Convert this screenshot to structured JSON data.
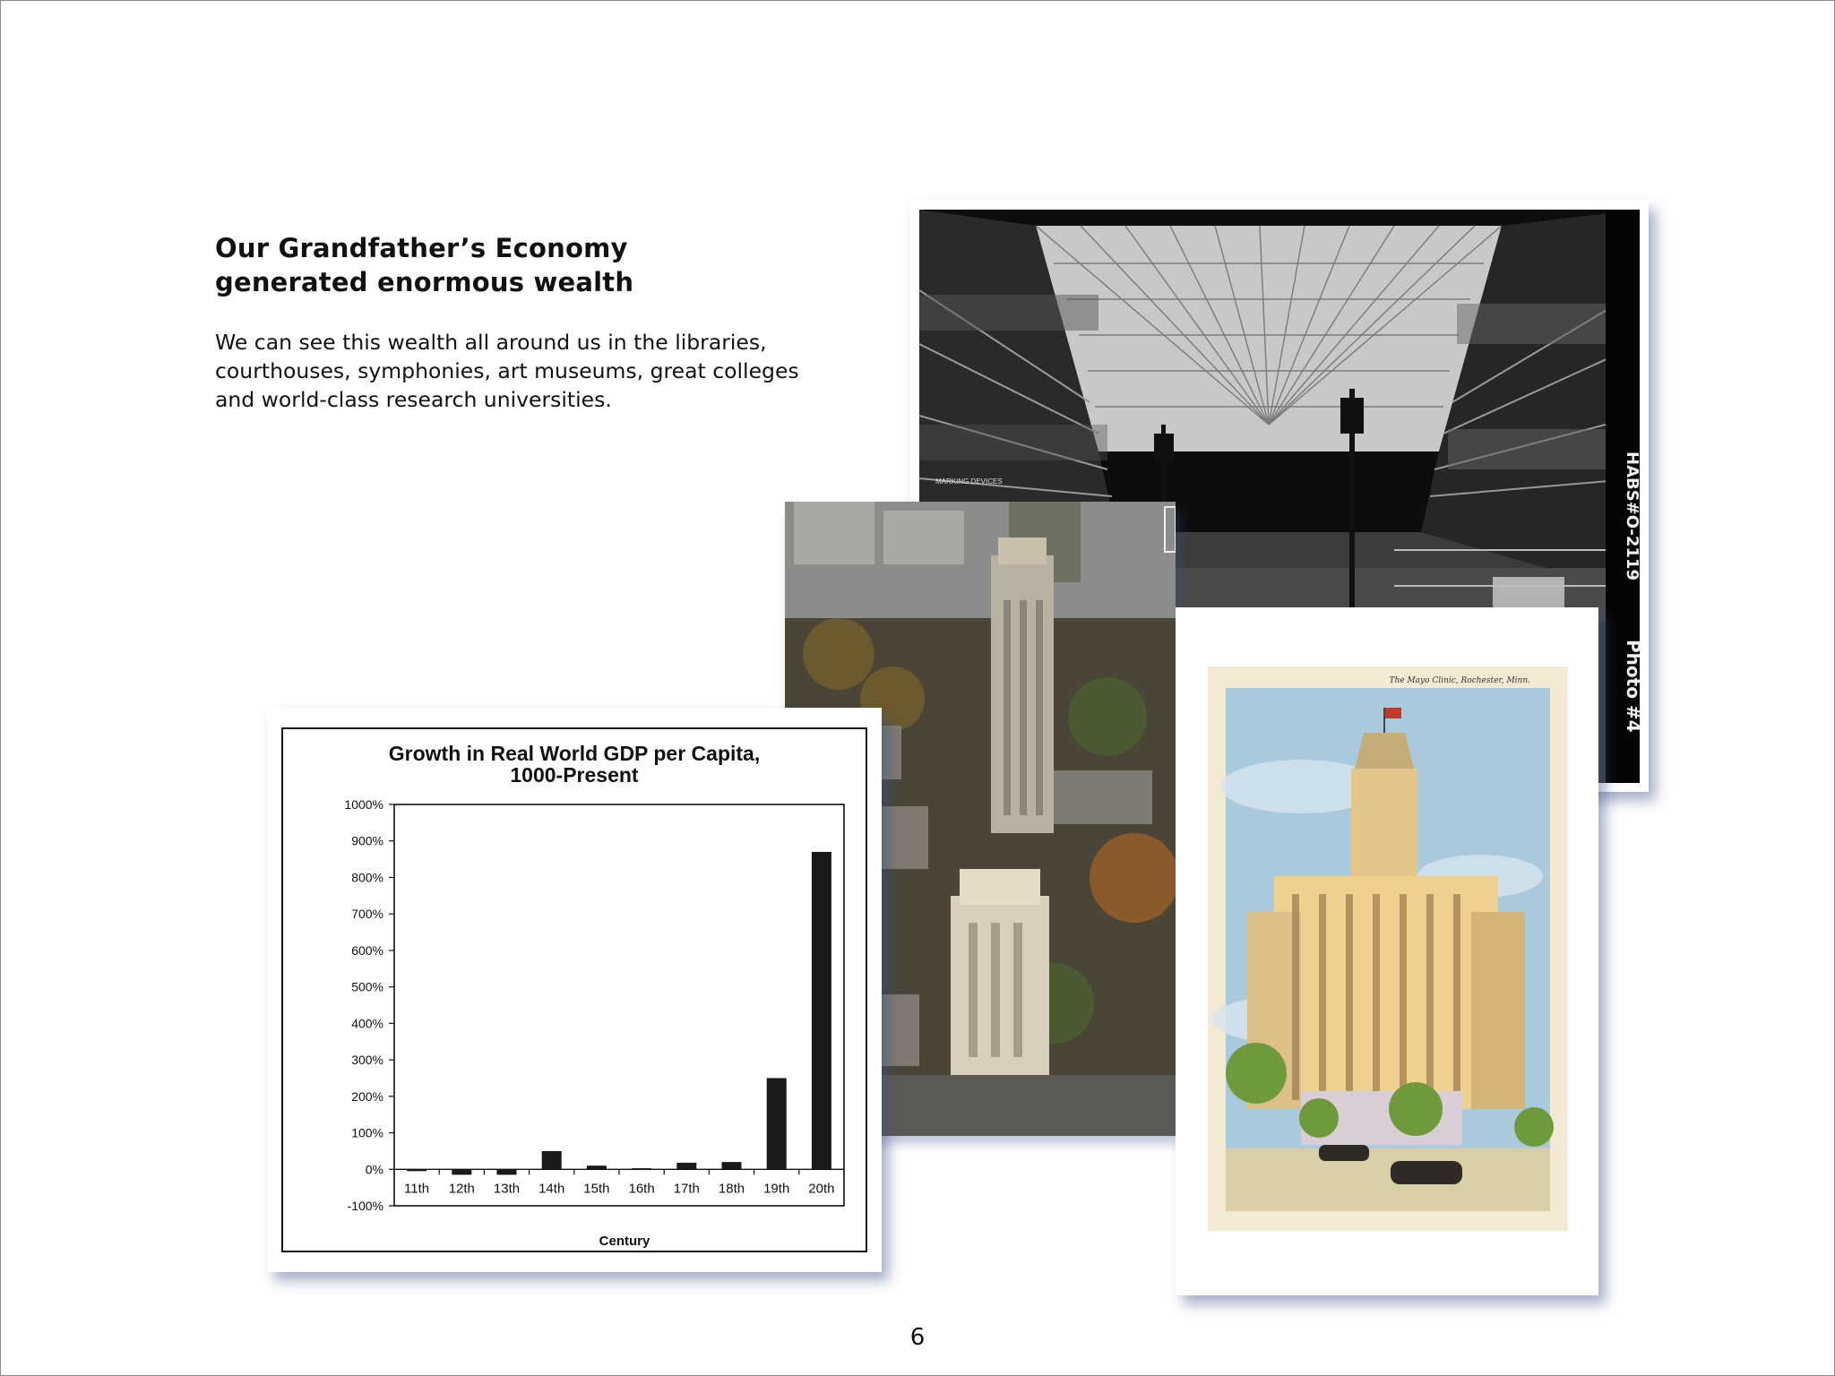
{
  "heading": {
    "line1": "Our Grandfather’s Economy",
    "line2": "generated enormous wealth"
  },
  "body": {
    "line1": "We can see this wealth all around us in the libraries,",
    "line2": "courthouses, symphonies, art museums, great colleges",
    "line3": "and world-class research universities."
  },
  "arcade_photo": {
    "sign": "MARKING DEVICES",
    "side_caption_1": "HABS#O-2119",
    "side_caption_2": "Photo #4"
  },
  "postcard": {
    "caption": "The Mayo Clinic, Rochester, Minn."
  },
  "chart_data": {
    "type": "bar",
    "title": "Growth in Real World GDP per Capita, 1000-Present",
    "title_line1": "Growth in Real World GDP per Capita,",
    "title_line2": "1000-Present",
    "xlabel": "Century",
    "ylabel": "",
    "categories": [
      "11th",
      "12th",
      "13th",
      "14th",
      "15th",
      "16th",
      "17th",
      "18th",
      "19th",
      "20th"
    ],
    "values": [
      -5,
      -15,
      -15,
      50,
      10,
      3,
      18,
      20,
      250,
      870
    ],
    "ylim": [
      -100,
      1000
    ],
    "yticks": [
      "1000%",
      "900%",
      "800%",
      "700%",
      "600%",
      "500%",
      "400%",
      "300%",
      "200%",
      "100%",
      "0%",
      "-100%"
    ],
    "ytick_values": [
      1000,
      900,
      800,
      700,
      600,
      500,
      400,
      300,
      200,
      100,
      0,
      -100
    ],
    "grid": false
  },
  "page_number": "6"
}
